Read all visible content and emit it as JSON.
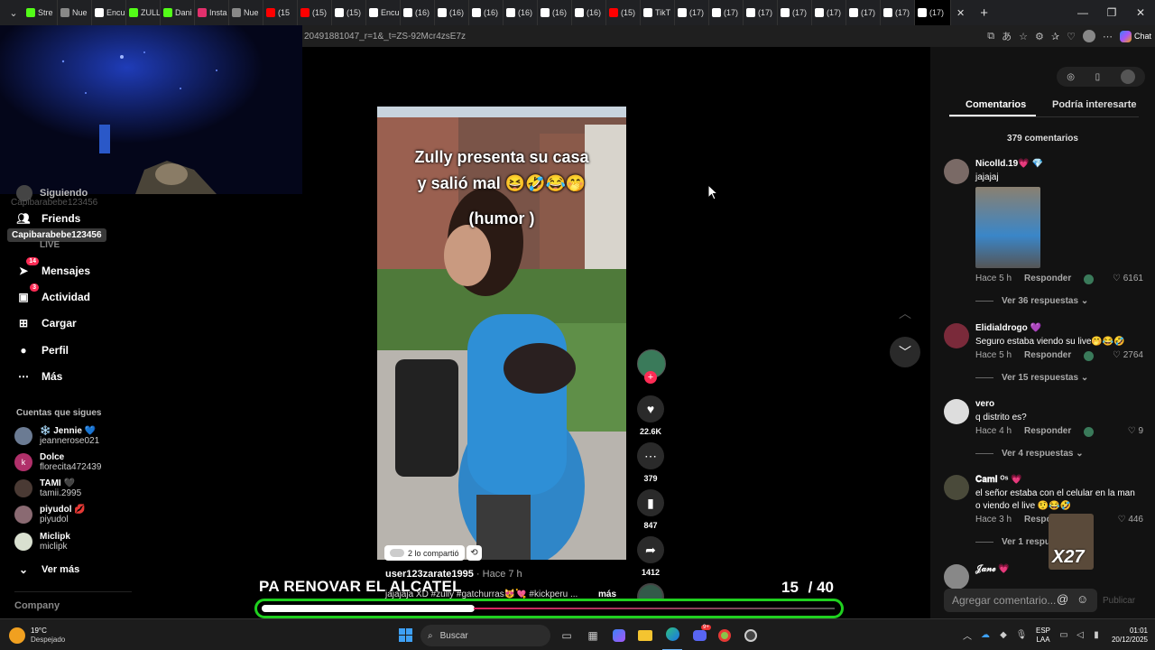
{
  "browser": {
    "tabs": [
      {
        "label": "Stre",
        "icon": "kick-icon",
        "color": "#53fc18"
      },
      {
        "label": "Nue",
        "icon": "page-icon",
        "color": "#888888"
      },
      {
        "label": "Encu",
        "icon": "tiktok-icon",
        "color": "#ffffff"
      },
      {
        "label": "ZULL",
        "icon": "kick-icon",
        "color": "#53fc18"
      },
      {
        "label": "Dani",
        "icon": "kick-icon",
        "color": "#53fc18"
      },
      {
        "label": "Insta",
        "icon": "instagram-icon",
        "color": "#e1306c"
      },
      {
        "label": "Nue",
        "icon": "page-icon",
        "color": "#888888"
      },
      {
        "label": "(15",
        "icon": "youtube-icon",
        "color": "#ff0000"
      },
      {
        "label": "(15)",
        "icon": "youtube-icon",
        "color": "#ff0000"
      },
      {
        "label": "(15)",
        "icon": "tiktok-icon",
        "color": "#ffffff"
      },
      {
        "label": "Encu",
        "icon": "tiktok-icon",
        "color": "#ffffff"
      },
      {
        "label": "(16)",
        "icon": "tiktok-icon",
        "color": "#ffffff"
      },
      {
        "label": "(16)",
        "icon": "tiktok-icon",
        "color": "#ffffff"
      },
      {
        "label": "(16)",
        "icon": "tiktok-icon",
        "color": "#ffffff"
      },
      {
        "label": "(16)",
        "icon": "tiktok-icon",
        "color": "#ffffff"
      },
      {
        "label": "(16)",
        "icon": "tiktok-icon",
        "color": "#ffffff"
      },
      {
        "label": "(16)",
        "icon": "tiktok-icon",
        "color": "#ffffff"
      },
      {
        "label": "(15)",
        "icon": "youtube-icon",
        "color": "#ff0000"
      },
      {
        "label": "TikT",
        "icon": "tiktok-icon",
        "color": "#ffffff"
      },
      {
        "label": "(17)",
        "icon": "tiktok-icon",
        "color": "#ffffff"
      },
      {
        "label": "(17)",
        "icon": "tiktok-icon",
        "color": "#ffffff"
      },
      {
        "label": "(17)",
        "icon": "tiktok-icon",
        "color": "#ffffff"
      },
      {
        "label": "(17)",
        "icon": "tiktok-icon",
        "color": "#ffffff"
      },
      {
        "label": "(17)",
        "icon": "tiktok-icon",
        "color": "#ffffff"
      },
      {
        "label": "(17)",
        "icon": "tiktok-icon",
        "color": "#ffffff"
      },
      {
        "label": "(17)",
        "icon": "tiktok-icon",
        "color": "#ffffff"
      },
      {
        "label": "(17)",
        "icon": "tiktok-icon",
        "color": "#ffffff"
      }
    ],
    "url": "20491881047_r=1&_t=ZS-92Mcr4zsE7z",
    "chat_label": "Chat"
  },
  "sidebar": {
    "hidden_item": "Siguiendo",
    "hidden_user": "Capibarabebe123456",
    "tooltip_user": "Capibarabebe123456",
    "friends_label": "Friends",
    "live_label": "LIVE",
    "items": [
      {
        "label": "Mensajes",
        "icon": "send-icon",
        "badge": "14"
      },
      {
        "label": "Actividad",
        "icon": "activity-icon",
        "badge": "3"
      },
      {
        "label": "Cargar",
        "icon": "upload-icon",
        "badge": ""
      },
      {
        "label": "Perfil",
        "icon": "profile-icon",
        "badge": ""
      },
      {
        "label": "Más",
        "icon": "more-icon",
        "badge": ""
      }
    ],
    "following_title": "Cuentas que sigues",
    "following": [
      {
        "name": "❄️ Jennie 💙",
        "user": "jeannerose021",
        "avatar_color": "#6b7b93"
      },
      {
        "name": "Dolce",
        "user": "florecita472439",
        "avatar_color": "#b0306a",
        "letter": "k"
      },
      {
        "name": "TAMI 🖤",
        "user": "tamii.2995",
        "avatar_color": "#4a3a34"
      },
      {
        "name": "piyudol 💋",
        "user": "piyudol",
        "avatar_color": "#8a6a72"
      },
      {
        "name": "Miclipk",
        "user": "miclipk",
        "avatar_color": "#d9e0d0"
      }
    ],
    "see_more": "Ver más",
    "company": "Company"
  },
  "video": {
    "caption_line1": "Zully presenta su casa",
    "caption_line2": "y salió mal 😆🤣😂🤭",
    "caption_line3": "(humor )",
    "shared_text": "2 lo compartió",
    "author": "user123zarate1995",
    "time": " · Hace 7 h",
    "description": "jajajaja XD #zully #gatchurras😻💘 #kickperu ...",
    "more": "más"
  },
  "actions": {
    "likes": "22.6K",
    "comments": "379",
    "saves": "847",
    "shares": "1412"
  },
  "overlay": {
    "title": "PA RENOVAR EL ALCATEL",
    "current": "15",
    "total": "/ 40",
    "progress": 0.37
  },
  "comments_panel": {
    "tab_comments": "Comentarios",
    "tab_interest": "Podría interesarte",
    "count": "379 comentarios",
    "items": [
      {
        "name": "Nicolld.19💗 💎",
        "text": "jajajaj",
        "time": "Hace 5 h",
        "reply": "Responder",
        "likes": "6161",
        "more": "Ver 36 respuestas ⌄",
        "avatar_color": "#7a6a66"
      },
      {
        "name": "Elidialdrogo 💜",
        "text": "Seguro estaba viendo su live🤭😂🤣",
        "time": "Hace 5 h",
        "reply": "Responder",
        "likes": "2764",
        "more": "Ver 15 respuestas ⌄",
        "avatar_color": "#7a2a3a"
      },
      {
        "name": "vero",
        "text": "q distrito es?",
        "time": "Hace 4 h",
        "reply": "Responder",
        "likes": "9",
        "more": "Ver 4 respuestas ⌄",
        "avatar_color": "#dddddd"
      },
      {
        "name": "𝐂𝐚𝐦𝐢 ᴼˢ 💗",
        "text": "el señor estaba con el celular en la man o viendo el live 🤨😂🤣",
        "time": "Hace 3 h",
        "reply": "Responder",
        "likes": "446",
        "more": "Ver 1 respuesta",
        "avatar_color": "#4a4a3a"
      },
      {
        "name": "𝒥𝒶𝓃ℯ 💗",
        "text": "",
        "time": "",
        "reply": "",
        "likes": "",
        "more": "",
        "avatar_color": "#888888"
      }
    ],
    "input_placeholder": "Agregar comentario...",
    "publish": "Publicar",
    "sticker_label": "X27"
  },
  "taskbar": {
    "weather_temp": "19°C",
    "weather_desc": "Despejado",
    "search": "Buscar",
    "lang1": "ESP",
    "lang2": "LAA",
    "time": "01:01",
    "date": "20/12/2025",
    "discord_badge": "9+"
  }
}
